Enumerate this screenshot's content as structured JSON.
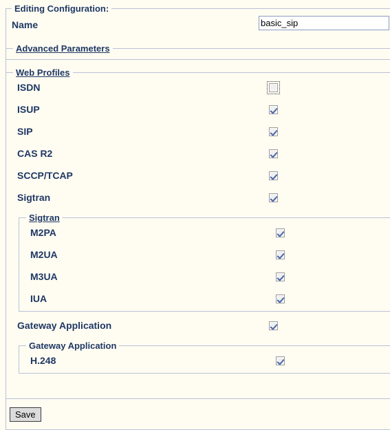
{
  "page": {
    "legend": "Editing Configuration:",
    "background_color": "#FFFCF2",
    "text_color": "#1F3864"
  },
  "name_field": {
    "label": "Name",
    "value": "basic_sip",
    "placeholder": ""
  },
  "advanced_parameters": {
    "legend": "Advanced Parameters",
    "is_link": true,
    "expanded": false
  },
  "web_profiles": {
    "legend": "Web Profiles",
    "is_link": true,
    "items": [
      {
        "label": "ISDN",
        "checked": false,
        "focused": true
      },
      {
        "label": "ISUP",
        "checked": true,
        "focused": false
      },
      {
        "label": "SIP",
        "checked": true,
        "focused": false
      },
      {
        "label": "CAS R2",
        "checked": true,
        "focused": false
      },
      {
        "label": "SCCP/TCAP",
        "checked": true,
        "focused": false
      },
      {
        "label": "Sigtran",
        "checked": true,
        "focused": false
      }
    ]
  },
  "sigtran_group": {
    "legend": "Sigtran",
    "is_link": true,
    "items": [
      {
        "label": "M2PA",
        "checked": true
      },
      {
        "label": "M2UA",
        "checked": true
      },
      {
        "label": "M3UA",
        "checked": true
      },
      {
        "label": "IUA",
        "checked": true
      }
    ]
  },
  "gateway_application_row": {
    "label": "Gateway Application",
    "checked": true
  },
  "gateway_application_group": {
    "legend": "Gateway Application",
    "is_link": false,
    "items": [
      {
        "label": "H.248",
        "checked": true
      }
    ]
  },
  "actions": {
    "save_label": "Save"
  }
}
